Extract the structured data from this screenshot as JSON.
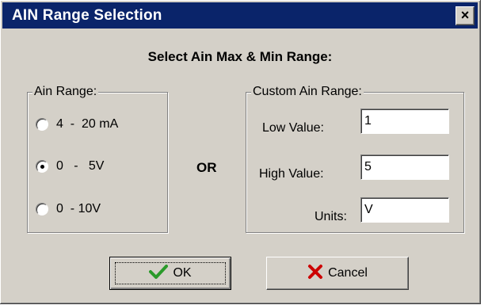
{
  "window": {
    "title": "AIN Range Selection",
    "close_glyph": "×"
  },
  "heading": "Select Ain Max & Min Range:",
  "ain_range": {
    "legend": "Ain Range:",
    "options": [
      {
        "label": "4  -  20 mA",
        "checked": false
      },
      {
        "label": "0   -   5V",
        "checked": true
      },
      {
        "label": "0  - 10V",
        "checked": false
      }
    ]
  },
  "or_label": "OR",
  "custom_range": {
    "legend": "Custom Ain Range:",
    "low_label": "Low Value:",
    "low_value": "1",
    "high_label": "High Value:",
    "high_value": "5",
    "units_label": "Units:",
    "units_value": "V"
  },
  "buttons": {
    "ok_label": "OK",
    "ok_icon": "checkmark-icon",
    "cancel_label": "Cancel",
    "cancel_icon": "x-icon"
  },
  "colors": {
    "titlebar": "#0a246a",
    "face": "#d4d0c8",
    "check_green": "#2a9a2a",
    "cancel_red": "#cc0000"
  }
}
